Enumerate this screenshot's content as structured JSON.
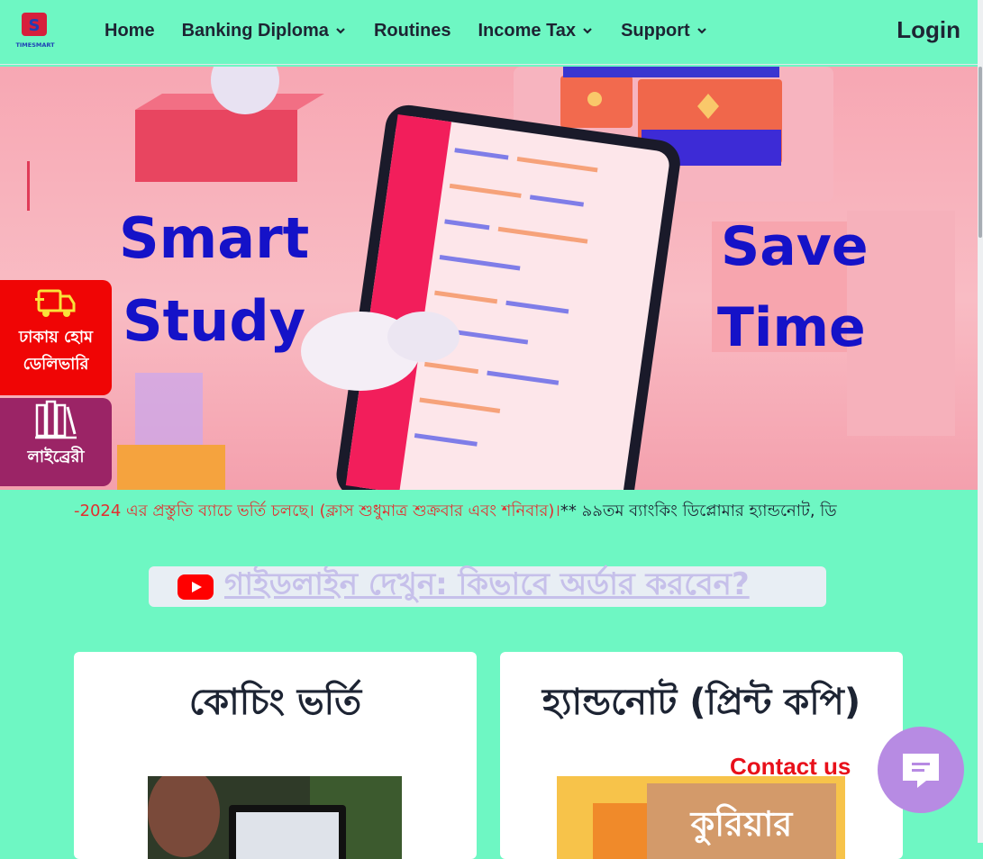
{
  "header": {
    "logo_text": "TIMESMART",
    "nav": [
      {
        "label": "Home",
        "dropdown": false
      },
      {
        "label": "Banking Diploma",
        "dropdown": true
      },
      {
        "label": "Routines",
        "dropdown": false
      },
      {
        "label": "Income Tax",
        "dropdown": true
      },
      {
        "label": "Support",
        "dropdown": true
      }
    ],
    "login_label": "Login"
  },
  "hero": {
    "left_line1": "Smart",
    "left_line2": "Study",
    "right_line1": "Save",
    "right_line2": "Time"
  },
  "side_buttons": {
    "delivery_line1": "ঢাকায় হোম",
    "delivery_line2": "ডেলিভারি",
    "library_label": "লাইব্রেরী"
  },
  "marquee": {
    "red_text": "-2024 এর প্রস্তুতি ব্যাচে ভর্তি চলছে। (ক্লাস শুধুমাত্র শুক্রবার এবং শনিবার)।",
    "dark_text": "** ৯৯তম ব্যাংকিং ডিপ্লোমার হ্যান্ডনোট, ডি"
  },
  "guide": {
    "text": "গাইডলাইন দেখুন: কিভাবে অর্ডার করবেন?"
  },
  "cards": [
    {
      "title": "কোচিং ভর্তি"
    },
    {
      "title": "হ্যান্ডনোট (প্রিন্ট কপি)",
      "image_text": "কুরিয়ার"
    }
  ],
  "contact": {
    "label": "Contact us"
  },
  "colors": {
    "page_bg": "#6ef7c3",
    "hero_text": "#1512c8",
    "delivery_bg": "#f00505",
    "library_bg": "#9b2466",
    "contact_red": "#e8101a",
    "contact_button": "#b78be3"
  }
}
